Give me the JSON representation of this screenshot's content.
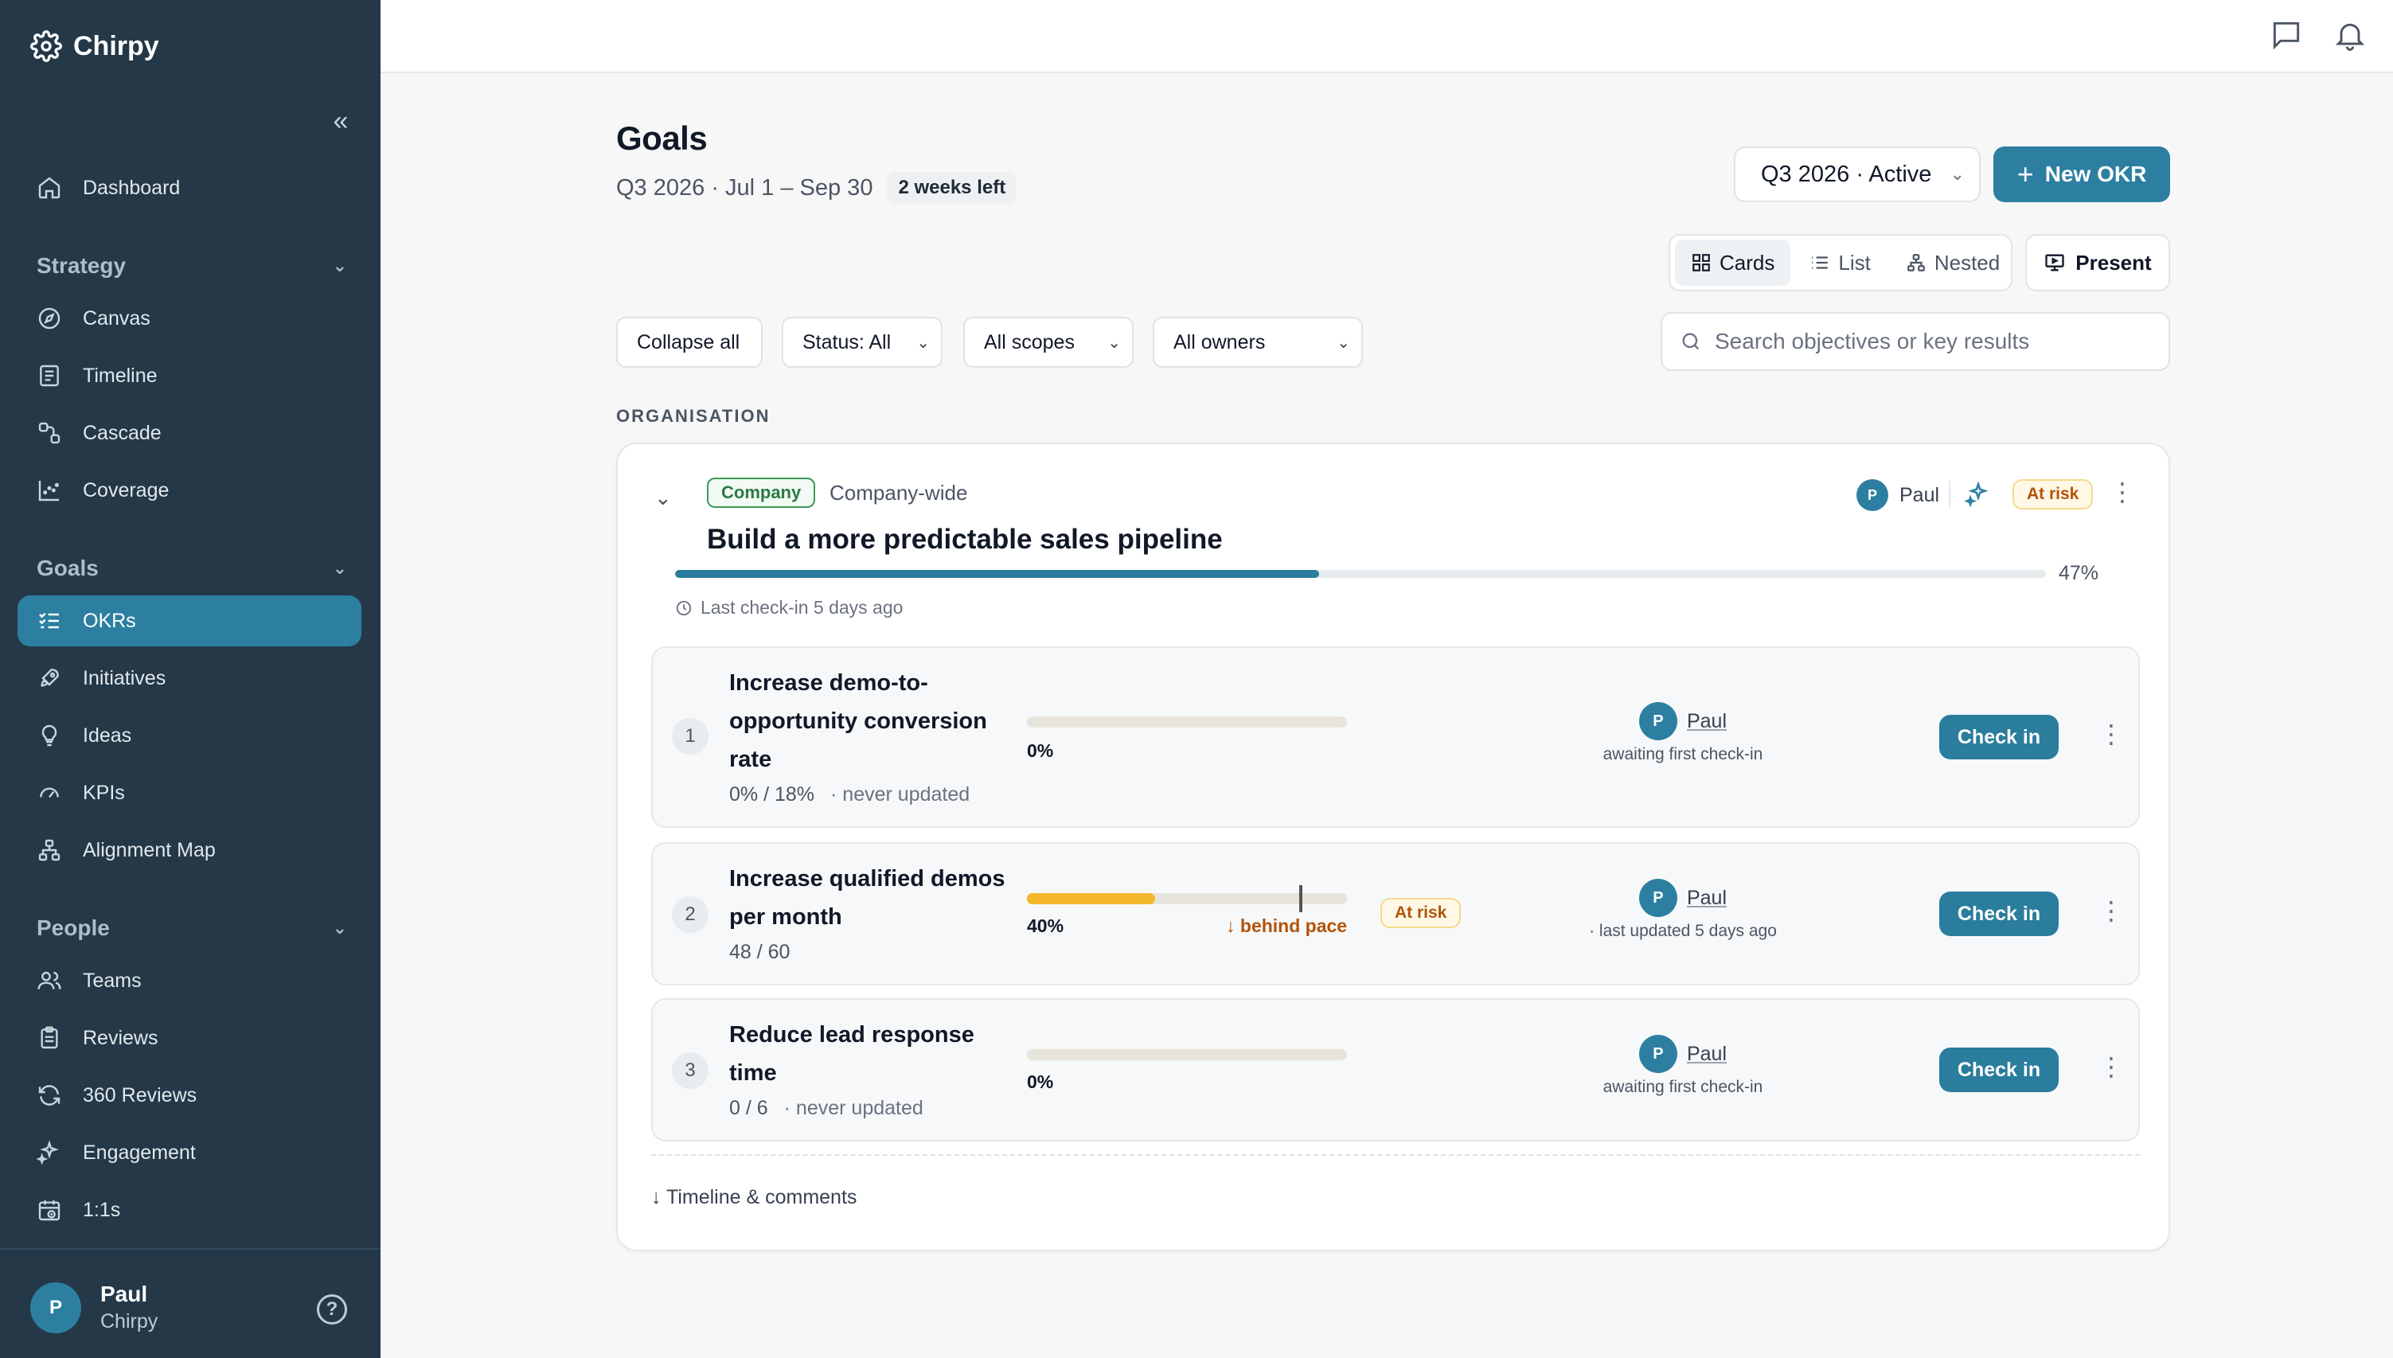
{
  "app": {
    "name": "Chirpy"
  },
  "sidebar": {
    "collapse_glyph": "«",
    "dashboard": "Dashboard",
    "sections": {
      "strategy": {
        "title": "Strategy",
        "items": [
          "Canvas",
          "Timeline",
          "Cascade",
          "Coverage"
        ]
      },
      "goals": {
        "title": "Goals",
        "items": [
          "OKRs",
          "Initiatives",
          "Ideas",
          "KPIs",
          "Alignment Map"
        ]
      },
      "people": {
        "title": "People",
        "items": [
          "Teams",
          "Reviews",
          "360 Reviews",
          "Engagement",
          "1:1s"
        ]
      }
    },
    "active_item": "OKRs",
    "user": {
      "initial": "P",
      "name": "Paul",
      "org": "Chirpy"
    }
  },
  "header": {
    "title": "Goals",
    "subtitle": "Q3 2026 · Jul 1 – Sep 30",
    "time_badge": "2 weeks left",
    "quarter_select": "Q3 2026 · Active",
    "new_okr": "New OKR",
    "views": [
      "Cards",
      "List",
      "Nested"
    ],
    "active_view": "Cards",
    "present": "Present"
  },
  "filters": {
    "collapse_all": "Collapse all",
    "status": "Status: All",
    "scopes": "All scopes",
    "owners": "All owners",
    "search_placeholder": "Search objectives or key results"
  },
  "section_label": "ORGANISATION",
  "objective": {
    "scope_badge": "Company",
    "scope_text": "Company-wide",
    "title": "Build a more predictable sales pipeline",
    "owner_initial": "P",
    "owner": "Paul",
    "status": "At risk",
    "progress": 0.47,
    "progress_label": "47%",
    "last_checkin": "Last check-in 5 days ago",
    "timeline_link": "↓ Timeline & comments",
    "key_results": [
      {
        "num": "1",
        "title": "Increase demo-to-opportunity conversion rate",
        "value": "0% / 18%",
        "updated": "· never updated",
        "progress": 0,
        "pct": "0%",
        "owner_initial": "P",
        "owner": "Paul",
        "owner_status": "awaiting first check-in",
        "checkin": "Check in"
      },
      {
        "num": "2",
        "title": "Increase qualified demos per month",
        "value": "48 / 60",
        "updated": "",
        "progress": 0.4,
        "expected": 0.85,
        "pct": "40%",
        "pace": "↓ behind pace",
        "status": "At risk",
        "owner_initial": "P",
        "owner": "Paul",
        "owner_status": "· last updated 5 days ago",
        "checkin": "Check in"
      },
      {
        "num": "3",
        "title": "Reduce lead response time",
        "value": "0 / 6",
        "updated": "· never updated",
        "progress": 0,
        "pct": "0%",
        "owner_initial": "P",
        "owner": "Paul",
        "owner_status": "awaiting first check-in",
        "checkin": "Check in"
      }
    ]
  },
  "colors": {
    "sidebar_bg": "#243847",
    "accent": "#2d7fa1",
    "warning": "#f4b82c",
    "company_badge": "#3a9a57"
  },
  "icons": {
    "top": [
      "chat-icon",
      "bell-icon"
    ]
  }
}
